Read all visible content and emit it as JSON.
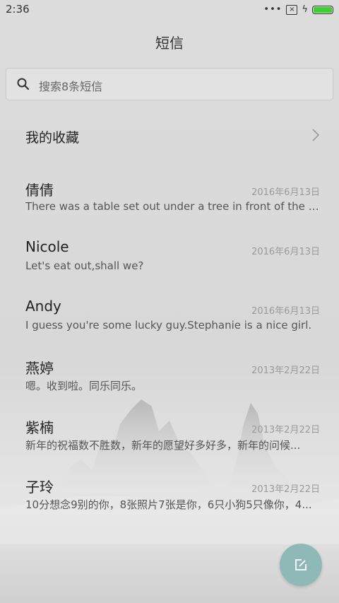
{
  "status_bar": {
    "time": "2:36"
  },
  "header": {
    "title": "短信"
  },
  "search": {
    "placeholder": "搜索8条短信"
  },
  "favorites": {
    "label": "我的收藏"
  },
  "threads": [
    {
      "name": "倩倩",
      "date": "2016年6月13日",
      "preview": "There was a table set out under a tree in front of the ho..."
    },
    {
      "name": "Nicole",
      "date": "2016年6月13日",
      "preview": "Let's eat out,shall we?"
    },
    {
      "name": "Andy",
      "date": "2016年6月13日",
      "preview": "I guess you're some lucky guy.Stephanie is a nice girl."
    },
    {
      "name": "燕婷",
      "date": "2013年2月22日",
      "preview": "嗯。收到啦。同乐同乐。"
    },
    {
      "name": "紫楠",
      "date": "2013年2月22日",
      "preview": "新年的祝福数不胜数，新年的愿望好多好多，新年的问候..."
    },
    {
      "name": "子玲",
      "date": "2013年2月22日",
      "preview": "10分想念9别的你，8张照片7张是你，6只小狗5只像你，4..."
    }
  ],
  "colors": {
    "accent": "#8fb9b6",
    "battery": "#3ecf32"
  },
  "icons": [
    "search-icon",
    "chevron-right-icon",
    "compose-icon",
    "battery-icon",
    "charging-icon",
    "sim-icon",
    "signal-dots-icon"
  ]
}
